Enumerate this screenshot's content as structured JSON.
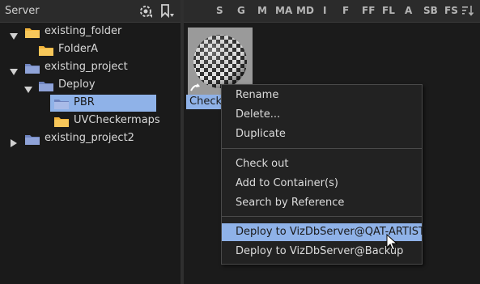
{
  "left_panel": {
    "title": "Server",
    "tree": [
      {
        "label": "existing_folder",
        "expanded": true
      },
      {
        "label": "FolderA"
      },
      {
        "label": "existing_project",
        "expanded": true
      },
      {
        "label": "Deploy",
        "expanded": true
      },
      {
        "label": "PBR",
        "selected": true
      },
      {
        "label": "UVCheckermaps"
      },
      {
        "label": "existing_project2",
        "expanded": false
      }
    ]
  },
  "toolbar": {
    "filters": [
      "S",
      "G",
      "M",
      "MA",
      "MD",
      "I",
      "F",
      "FF",
      "FL",
      "A",
      "SB",
      "FS"
    ]
  },
  "content": {
    "item_label": "Checke"
  },
  "context_menu": {
    "items": [
      "Rename",
      "Delete...",
      "Duplicate",
      "Check out",
      "Add to Container(s)",
      "Search by Reference",
      "Deploy to VizDbServer@QAT-ARTIST",
      "Deploy to VizDbServer@Backup"
    ],
    "highlighted": "Deploy to VizDbServer@QAT-ARTIST"
  },
  "colors": {
    "selection": "#8fb2e8",
    "folder_yellow": "#f2b43c",
    "project_blue": "#8fa3d8"
  }
}
